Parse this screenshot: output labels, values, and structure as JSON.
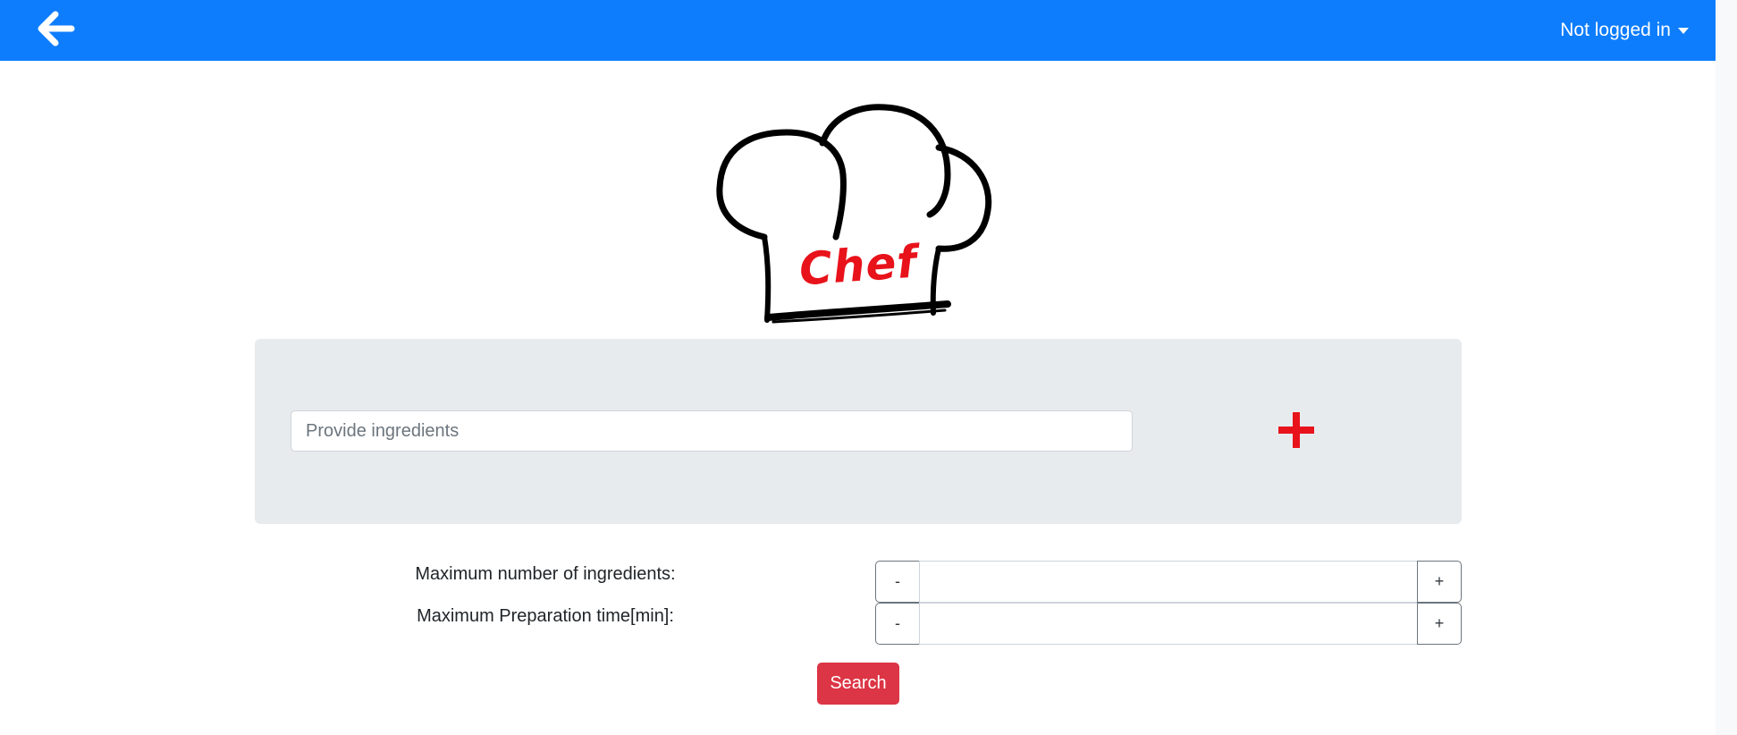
{
  "navbar": {
    "back_icon": "arrow-left-icon",
    "user_menu_label": "Not logged in",
    "caret_icon": "caret-down-icon",
    "background_color": "#0d7dfd"
  },
  "logo": {
    "text": "Chef",
    "icon": "chef-hat-icon",
    "text_color": "#e8121b"
  },
  "search_panel": {
    "ingredients_placeholder": "Provide ingredients",
    "ingredients_value": "",
    "add_icon": "plus-icon",
    "add_icon_color": "#e8121b"
  },
  "options": {
    "max_ingredients": {
      "label": "Maximum number of ingredients:",
      "minus_label": "-",
      "plus_label": "+",
      "value": ""
    },
    "max_time": {
      "label": "Maximum Preparation time[min]:",
      "minus_label": "-",
      "plus_label": "+",
      "value": ""
    }
  },
  "search_button": {
    "label": "Search",
    "color": "#dc3545"
  }
}
